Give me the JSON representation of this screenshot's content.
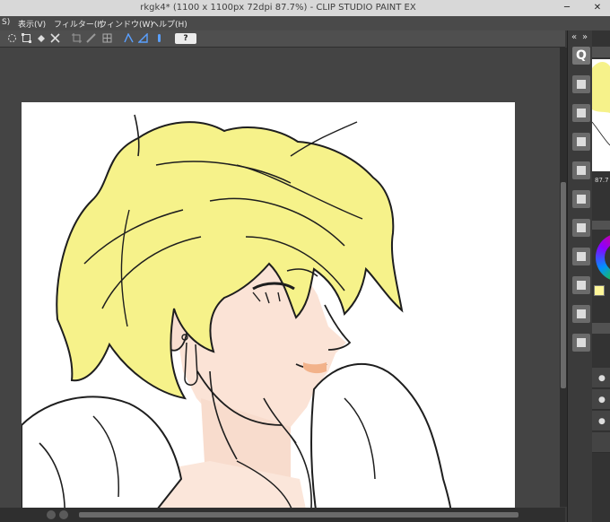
{
  "window": {
    "title": "rkgk4* (1100 x 1100px 72dpi 87.7%) - CLIP STUDIO PAINT EX",
    "minimize": "─",
    "close": "✕"
  },
  "menu": {
    "items": [
      {
        "label": "S)"
      },
      {
        "label": "表示(V)"
      },
      {
        "label": "フィルター(I)"
      },
      {
        "label": "ウィンドウ(W)"
      },
      {
        "label": "ヘルプ(H)"
      }
    ]
  },
  "command_bar": {
    "help_label": "?"
  },
  "right_panel": {
    "zoom_readout": "87.7",
    "collapse_labels": [
      "«",
      "»"
    ],
    "navigator_search": "Q"
  },
  "colors": {
    "hair": "#f6f28a",
    "skin": "#fbe3d6",
    "lips": "#f2b28a",
    "lineart": "#1e1e1e",
    "accent_color_wheel": "#e0007a",
    "current_color": "#fff79a"
  },
  "icons": {
    "command_bar": [
      "lasso-select-icon",
      "transform-icon",
      "fill-icon",
      "eraser-icon",
      "crop-icon",
      "ruler-icon",
      "grid-icon",
      "perspective-ruler-icon",
      "snap-icon",
      "pen-icon"
    ],
    "dock": [
      "search-icon",
      "layer-properties-icon",
      "tone-icon",
      "material-icon",
      "sub-view-icon",
      "navigator-icon",
      "color-wheel-icon",
      "color-set-icon",
      "layer-icon",
      "auto-action-icon",
      "history-icon"
    ]
  }
}
